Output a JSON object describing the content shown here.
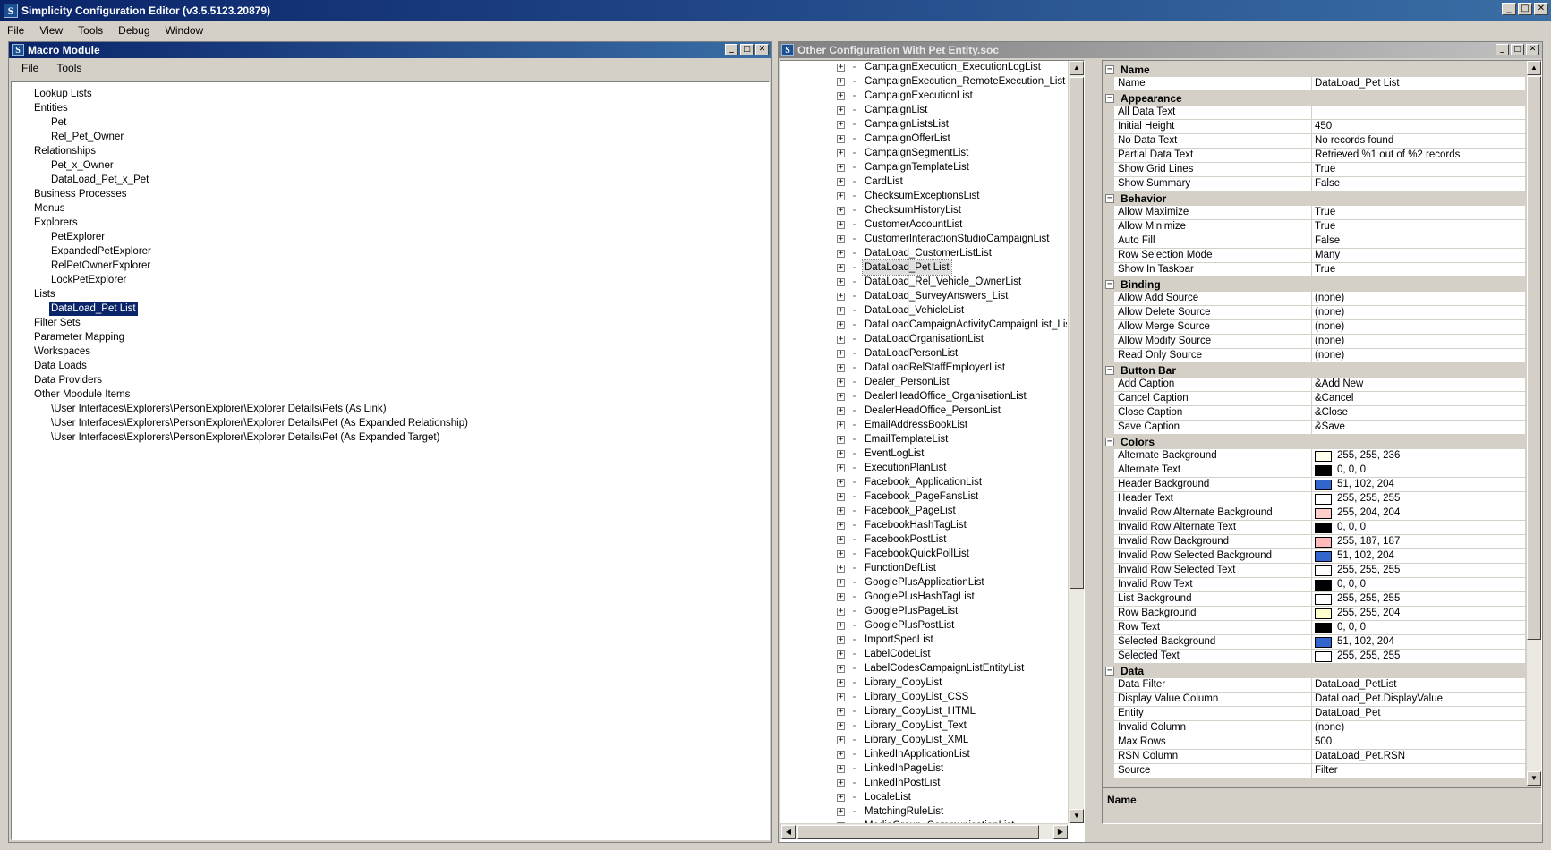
{
  "app": {
    "title": "Simplicity Configuration Editor (v3.5.5123.20879)",
    "icon_letter": "S"
  },
  "menubar": [
    "File",
    "View",
    "Tools",
    "Debug",
    "Window"
  ],
  "macro_module": {
    "title": "Macro Module",
    "menu": [
      "File",
      "Tools"
    ],
    "tree": [
      {
        "label": "Lookup Lists",
        "level": 0
      },
      {
        "label": "Entities",
        "level": 0
      },
      {
        "label": "Pet",
        "level": 1
      },
      {
        "label": "Rel_Pet_Owner",
        "level": 1
      },
      {
        "label": "Relationships",
        "level": 0
      },
      {
        "label": "Pet_x_Owner",
        "level": 1
      },
      {
        "label": "DataLoad_Pet_x_Pet",
        "level": 1
      },
      {
        "label": "Business Processes",
        "level": 0
      },
      {
        "label": "Menus",
        "level": 0
      },
      {
        "label": "Explorers",
        "level": 0
      },
      {
        "label": "PetExplorer",
        "level": 1
      },
      {
        "label": "ExpandedPetExplorer",
        "level": 1
      },
      {
        "label": "RelPetOwnerExplorer",
        "level": 1
      },
      {
        "label": "LockPetExplorer",
        "level": 1
      },
      {
        "label": "Lists",
        "level": 0
      },
      {
        "label": "DataLoad_Pet List",
        "level": 1,
        "selected": true
      },
      {
        "label": "Filter Sets",
        "level": 0
      },
      {
        "label": "Parameter Mapping",
        "level": 0
      },
      {
        "label": "Workspaces",
        "level": 0
      },
      {
        "label": "Data Loads",
        "level": 0
      },
      {
        "label": "Data Providers",
        "level": 0
      },
      {
        "label": "Other Moodule Items",
        "level": 0
      },
      {
        "label": "\\User Interfaces\\Explorers\\PersonExplorer\\Explorer Details\\Pets (As Link)",
        "level": 1
      },
      {
        "label": "\\User Interfaces\\Explorers\\PersonExplorer\\Explorer Details\\Pet (As Expanded Relationship)",
        "level": 1
      },
      {
        "label": "\\User Interfaces\\Explorers\\PersonExplorer\\Explorer Details\\Pet (As Expanded Target)",
        "level": 1
      }
    ]
  },
  "other_config": {
    "title": "Other Configuration With Pet Entity.soc",
    "list": [
      "CampaignExecution_ExecutionLogList",
      "CampaignExecution_RemoteExecution_List",
      "CampaignExecutionList",
      "CampaignList",
      "CampaignListsList",
      "CampaignOfferList",
      "CampaignSegmentList",
      "CampaignTemplateList",
      "CardList",
      "ChecksumExceptionsList",
      "ChecksumHistoryList",
      "CustomerAccountList",
      "CustomerInteractionStudioCampaignList",
      "DataLoad_CustomerListList",
      "DataLoad_Pet List",
      "DataLoad_Rel_Vehicle_OwnerList",
      "DataLoad_SurveyAnswers_List",
      "DataLoad_VehicleList",
      "DataLoadCampaignActivityCampaignList_List",
      "DataLoadOrganisationList",
      "DataLoadPersonList",
      "DataLoadRelStaffEmployerList",
      "Dealer_PersonList",
      "DealerHeadOffice_OrganisationList",
      "DealerHeadOffice_PersonList",
      "EmailAddressBookList",
      "EmailTemplateList",
      "EventLogList",
      "ExecutionPlanList",
      "Facebook_ApplicationList",
      "Facebook_PageFansList",
      "Facebook_PageList",
      "FacebookHashTagList",
      "FacebookPostList",
      "FacebookQuickPollList",
      "FunctionDefList",
      "GooglePlusApplicationList",
      "GooglePlusHashTagList",
      "GooglePlusPageList",
      "GooglePlusPostList",
      "ImportSpecList",
      "LabelCodeList",
      "LabelCodesCampaignListEntityList",
      "Library_CopyList",
      "Library_CopyList_CSS",
      "Library_CopyList_HTML",
      "Library_CopyList_Text",
      "Library_CopyList_XML",
      "LinkedInApplicationList",
      "LinkedInPageList",
      "LinkedInPostList",
      "LocaleList",
      "MatchingRuleList",
      "MediaGroup_CommunicationList"
    ],
    "highlighted": "DataLoad_Pet List",
    "expander": "+"
  },
  "properties": {
    "categories": [
      {
        "name": "Name",
        "props": [
          {
            "name": "Name",
            "value": "DataLoad_Pet List"
          }
        ]
      },
      {
        "name": "Appearance",
        "props": [
          {
            "name": "All Data Text",
            "value": ""
          },
          {
            "name": "Initial Height",
            "value": "450"
          },
          {
            "name": "No Data Text",
            "value": "No records found"
          },
          {
            "name": "Partial Data Text",
            "value": "Retrieved %1 out of %2 records"
          },
          {
            "name": "Show Grid Lines",
            "value": "True"
          },
          {
            "name": "Show Summary",
            "value": "False"
          }
        ]
      },
      {
        "name": "Behavior",
        "props": [
          {
            "name": "Allow Maximize",
            "value": "True"
          },
          {
            "name": "Allow Minimize",
            "value": "True"
          },
          {
            "name": "Auto Fill",
            "value": "False"
          },
          {
            "name": "Row Selection Mode",
            "value": "Many"
          },
          {
            "name": "Show In Taskbar",
            "value": "True"
          }
        ]
      },
      {
        "name": "Binding",
        "props": [
          {
            "name": "Allow Add Source",
            "value": "(none)"
          },
          {
            "name": "Allow Delete Source",
            "value": "(none)"
          },
          {
            "name": "Allow Merge Source",
            "value": "(none)"
          },
          {
            "name": "Allow Modify Source",
            "value": "(none)"
          },
          {
            "name": "Read Only Source",
            "value": "(none)"
          }
        ]
      },
      {
        "name": "Button Bar",
        "props": [
          {
            "name": "Add Caption",
            "value": "&Add New"
          },
          {
            "name": "Cancel Caption",
            "value": "&Cancel"
          },
          {
            "name": "Close Caption",
            "value": "&Close"
          },
          {
            "name": "Save Caption",
            "value": "&Save"
          }
        ]
      },
      {
        "name": "Colors",
        "props": [
          {
            "name": "Alternate Background",
            "value": "255, 255, 236",
            "color": "#ffffec"
          },
          {
            "name": "Alternate Text",
            "value": "0, 0, 0",
            "color": "#000000"
          },
          {
            "name": "Header Background",
            "value": "51, 102, 204",
            "color": "#3366cc"
          },
          {
            "name": "Header Text",
            "value": "255, 255, 255",
            "color": "#ffffff"
          },
          {
            "name": "Invalid Row Alternate Background",
            "value": "255, 204, 204",
            "color": "#ffcccc"
          },
          {
            "name": "Invalid Row Alternate Text",
            "value": "0, 0, 0",
            "color": "#000000"
          },
          {
            "name": "Invalid Row Background",
            "value": "255, 187, 187",
            "color": "#ffbbbb"
          },
          {
            "name": "Invalid Row Selected Background",
            "value": "51, 102, 204",
            "color": "#3366cc"
          },
          {
            "name": "Invalid Row Selected Text",
            "value": "255, 255, 255",
            "color": "#ffffff"
          },
          {
            "name": "Invalid Row Text",
            "value": "0, 0, 0",
            "color": "#000000"
          },
          {
            "name": "List Background",
            "value": "255, 255, 255",
            "color": "#ffffff"
          },
          {
            "name": "Row Background",
            "value": "255, 255, 204",
            "color": "#ffffcc"
          },
          {
            "name": "Row Text",
            "value": "0, 0, 0",
            "color": "#000000"
          },
          {
            "name": "Selected Background",
            "value": "51, 102, 204",
            "color": "#3366cc"
          },
          {
            "name": "Selected Text",
            "value": "255, 255, 255",
            "color": "#ffffff"
          }
        ]
      },
      {
        "name": "Data",
        "props": [
          {
            "name": "Data Filter",
            "value": "DataLoad_PetList"
          },
          {
            "name": "Display Value Column",
            "value": "DataLoad_Pet.DisplayValue"
          },
          {
            "name": "Entity",
            "value": "DataLoad_Pet"
          },
          {
            "name": "Invalid Column",
            "value": "(none)"
          },
          {
            "name": "Max Rows",
            "value": "500"
          },
          {
            "name": "RSN Column",
            "value": "DataLoad_Pet.RSN"
          },
          {
            "name": "Source",
            "value": "Filter"
          }
        ]
      }
    ],
    "description_title": "Name",
    "collapse_glyph": "−"
  },
  "window_buttons": {
    "minimize": "_",
    "maximize": "□",
    "close": "✕"
  }
}
